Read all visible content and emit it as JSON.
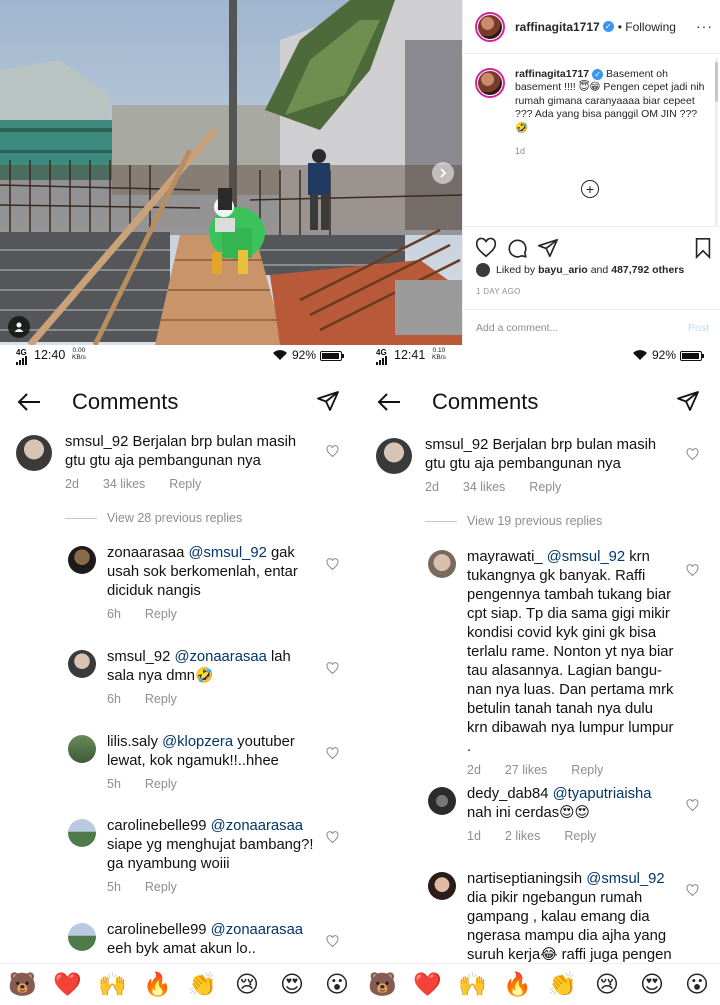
{
  "post": {
    "username": "raffinagita1717",
    "follow_status": "Following",
    "caption_text": "Basement oh basement !!!! 😇😁 Pengen cepet jadi nih rumah gimana caranyaaaa biar cepeet ??? Ada yang bisa panggil OM JIN ??? 🤣",
    "caption_time": "1d",
    "liked_by_prefix": "Liked by",
    "liked_by_user": "bayu_ario",
    "liked_by_and": "and",
    "likes_count": "487,792 others",
    "post_time": "1 DAY AGO",
    "add_comment_placeholder": "Add a comment...",
    "post_button": "Post"
  },
  "left_panel": {
    "status": {
      "network": "4G",
      "time": "12:40",
      "speed_value": "0.00",
      "speed_unit": "KB/s",
      "battery": "92%"
    },
    "title": "Comments",
    "main_comment": {
      "username": "smsul_92",
      "text": "Berjalan brp bulan masih gtu gtu aja pembangunan nya",
      "time": "2d",
      "likes": "34 likes",
      "reply": "Reply"
    },
    "view_replies": "View 28 previous replies",
    "replies": [
      {
        "username": "zonaarasaa",
        "mention": "@smsul_92",
        "text": "gak usah sok berkomenlah, entar diciduk nangis",
        "time": "6h",
        "reply": "Reply"
      },
      {
        "username": "smsul_92",
        "mention": "@zonaarasaa",
        "text": "lah sala nya dmn🤣",
        "time": "6h",
        "reply": "Reply"
      },
      {
        "username": "lilis.saly",
        "mention": "@klopzera",
        "text": "youtuber lewat, kok ngamuk!!..hhee",
        "time": "5h",
        "reply": "Reply"
      },
      {
        "username": "carolinebelle99",
        "mention": "@zonaarasaa",
        "text": "siape yg menghujat bambang?! ga nyambung woiii",
        "time": "5h",
        "reply": "Reply"
      },
      {
        "username": "carolinebelle99",
        "mention": "@zonaarasaa",
        "text": "eeh byk amat akun lo..",
        "time": "",
        "reply": ""
      }
    ]
  },
  "right_panel": {
    "status": {
      "network": "4G",
      "time": "12:41",
      "speed_value": "0.10",
      "speed_unit": "KB/s",
      "battery": "92%"
    },
    "title": "Comments",
    "main_comment": {
      "username": "smsul_92",
      "text": "Berjalan brp bulan masih gtu gtu aja pembangunan nya",
      "time": "2d",
      "likes": "34 likes",
      "reply": "Reply"
    },
    "view_replies": "View 19 previous replies",
    "replies": [
      {
        "username": "mayrawati_",
        "mention": "@smsul_92",
        "text": "krn tukangnya gk banyak. Raffi pengennya tambah tukang biar cpt siap. Tp dia sama gigi mikir kondisi covid kyk gini gk bisa terlalu rame. Nonton yt nya biar tau alasannya. Lagian bangu-nan nya luas. Dan pertama mrk betulin tanah tanah nya dulu krn dibawah nya lumpur lumpur .",
        "time": "2d",
        "likes": "27 likes",
        "reply": "Reply"
      },
      {
        "username": "dedy_dab84",
        "mention": "@tyaputriaisha",
        "text": "nah ini cerdas😍😍",
        "time": "1d",
        "likes": "2 likes",
        "reply": "Reply"
      },
      {
        "username": "nartiseptianingsih",
        "mention": "@smsul_92",
        "text": "dia pikir ngebangun rumah gampang , kalau emang dia ngerasa mampu dia ajha yang suruh kerja😂 raffi juga pengen",
        "time": "",
        "likes": "",
        "reply": ""
      }
    ]
  },
  "emoji_bar": [
    "🐻",
    "❤️",
    "🙌",
    "🔥",
    "👏",
    "😢",
    "😍",
    "😮",
    "🐻",
    "❤️",
    "🙌",
    "🔥",
    "👏",
    "😢",
    "😍",
    "😮"
  ],
  "colors": {
    "link": "#003569",
    "verified": "#3897f0",
    "meta": "#8e8e8e",
    "story_ring": "#d6249f"
  }
}
